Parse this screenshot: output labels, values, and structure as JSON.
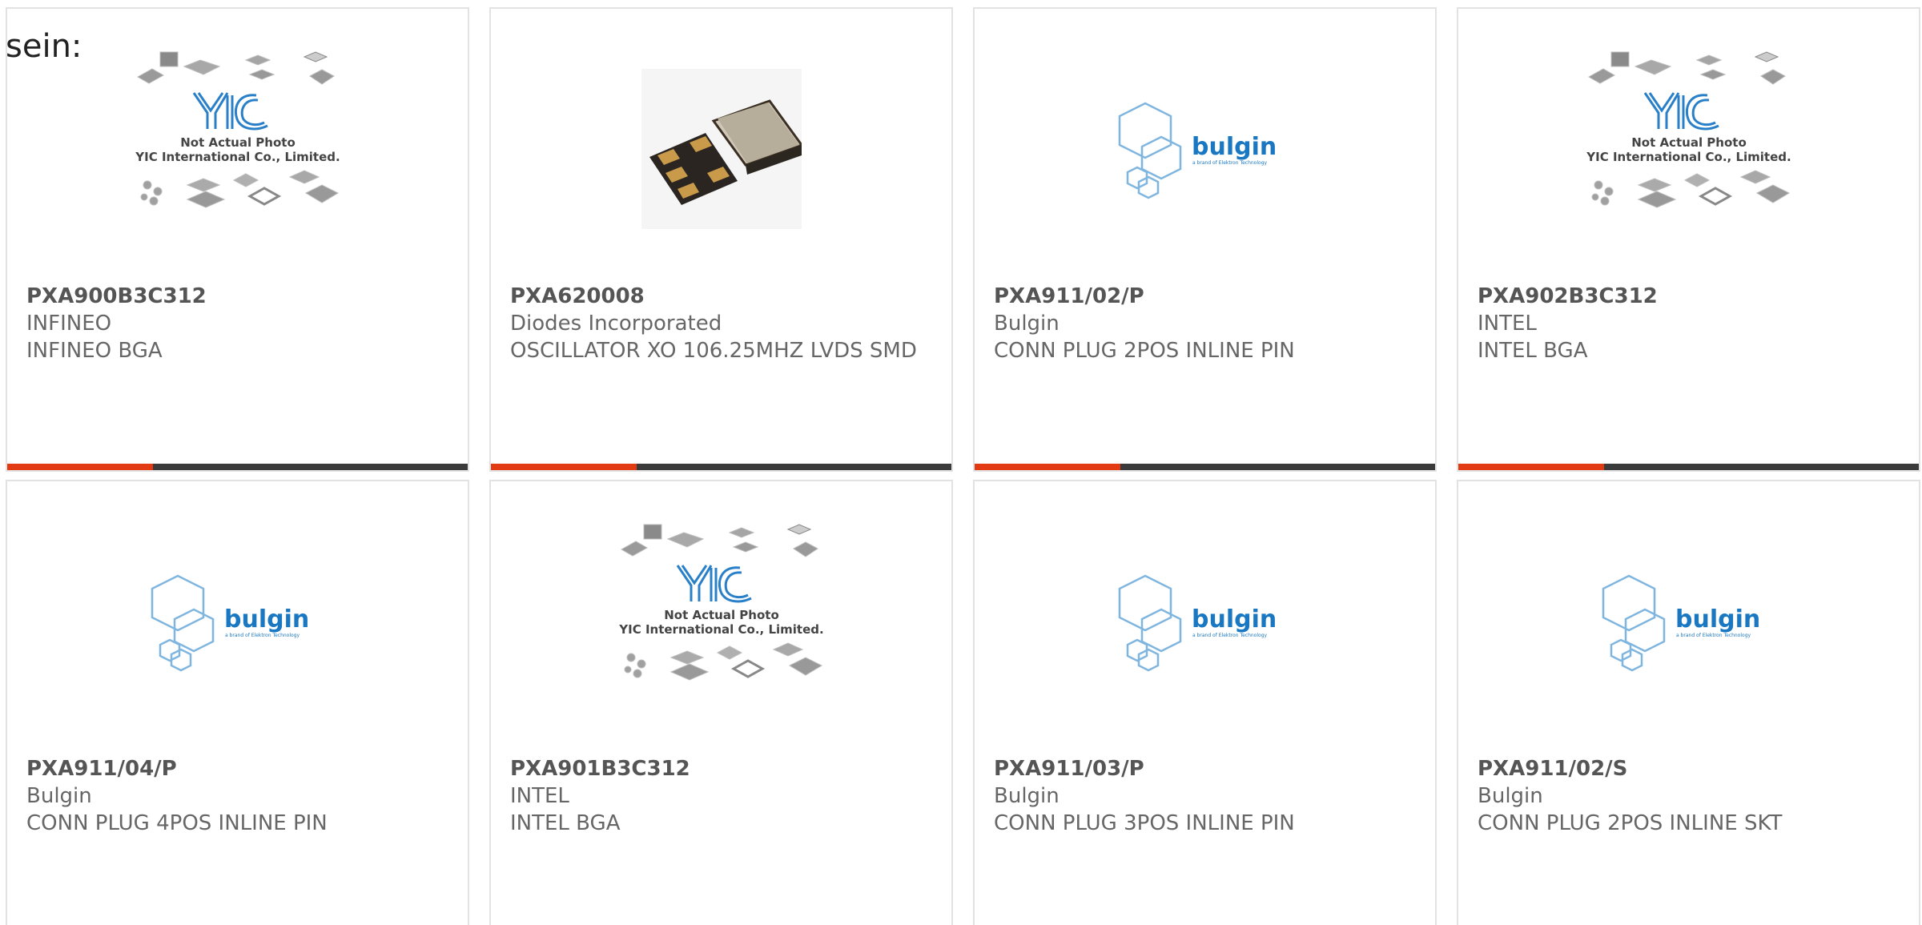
{
  "page": {
    "intro_text": "sein:"
  },
  "colors": {
    "accent": "#e23a12",
    "bar_dark": "#3b3b3b",
    "bulgin_blue": "#1a78c2",
    "yic_blue": "#2a80c8",
    "border": "#e2e2e2",
    "text_gray": "#666666"
  },
  "logos": {
    "yic": {
      "brand": "YIC",
      "line1": "Not Actual Photo",
      "line2": "YIC International Co., Limited."
    },
    "bulgin": {
      "brand": "bulgin",
      "tagline": "a brand of Elektron Technology"
    }
  },
  "products": [
    {
      "part": "PXA900B3C312",
      "manufacturer": "INFINEO",
      "description": "INFINEO BGA",
      "image": "yic-placeholder",
      "bar": true
    },
    {
      "part": "PXA620008",
      "manufacturer": "Diodes Incorporated",
      "description": "OSCILLATOR XO 106.25MHZ LVDS SMD",
      "image": "oscillator-photo",
      "bar": true
    },
    {
      "part": "PXA911/02/P",
      "manufacturer": "Bulgin",
      "description": "CONN PLUG 2POS INLINE PIN",
      "image": "bulgin-logo",
      "bar": true
    },
    {
      "part": "PXA902B3C312",
      "manufacturer": "INTEL",
      "description": "INTEL BGA",
      "image": "yic-placeholder",
      "bar": true
    },
    {
      "part": "PXA911/04/P",
      "manufacturer": "Bulgin",
      "description": "CONN PLUG 4POS INLINE PIN",
      "image": "bulgin-logo",
      "bar": false
    },
    {
      "part": "PXA901B3C312",
      "manufacturer": "INTEL",
      "description": "INTEL BGA",
      "image": "yic-placeholder",
      "bar": false
    },
    {
      "part": "PXA911/03/P",
      "manufacturer": "Bulgin",
      "description": "CONN PLUG 3POS INLINE PIN",
      "image": "bulgin-logo",
      "bar": false
    },
    {
      "part": "PXA911/02/S",
      "manufacturer": "Bulgin",
      "description": "CONN PLUG 2POS INLINE SKT",
      "image": "bulgin-logo",
      "bar": false
    }
  ]
}
